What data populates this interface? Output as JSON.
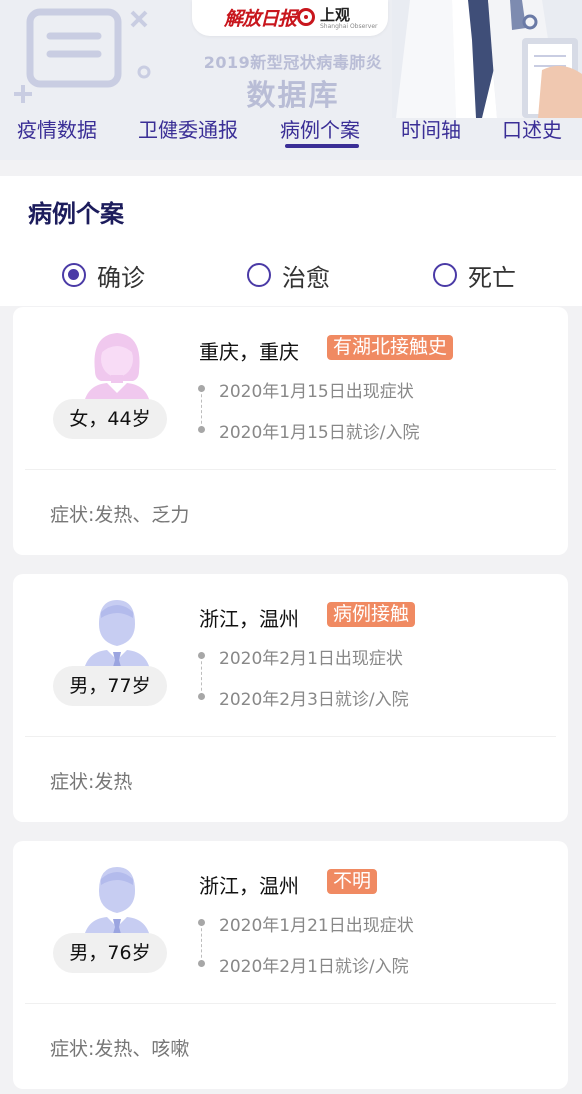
{
  "header": {
    "logo_jfrb": "解放日报",
    "logo_shangguan": "上观",
    "logo_shangguan_sub": "Shanghai Observer",
    "title_line1": "2019新型冠状病毒肺炎",
    "title_line2": "数据库",
    "nav": [
      {
        "label": "疫情数据"
      },
      {
        "label": "卫健委通报"
      },
      {
        "label": "病例个案",
        "active": true
      },
      {
        "label": "时间轴"
      },
      {
        "label": "口述史"
      }
    ],
    "accent_color": "#3a2e96"
  },
  "section": {
    "title": "病例个案",
    "filters": [
      {
        "label": "确诊",
        "selected": true
      },
      {
        "label": "治愈",
        "selected": false
      },
      {
        "label": "死亡",
        "selected": false
      }
    ]
  },
  "cases": [
    {
      "gender_icon": "female-avatar-icon",
      "person": "女，44岁",
      "location": "重庆，重庆",
      "tag": "有湖北接触史",
      "onset": "2020年1月15日出现症状",
      "admitted": "2020年1月15日就诊/入院",
      "symptoms": "症状:发热、乏力"
    },
    {
      "gender_icon": "male-avatar-icon",
      "person": "男，77岁",
      "location": "浙江，温州",
      "tag": "病例接触",
      "onset": "2020年2月1日出现症状",
      "admitted": "2020年2月3日就诊/入院",
      "symptoms": "症状:发热"
    },
    {
      "gender_icon": "male-avatar-icon",
      "person": "男，76岁",
      "location": "浙江，温州",
      "tag": "不明",
      "onset": "2020年1月21日出现症状",
      "admitted": "2020年2月1日就诊/入院",
      "symptoms": "症状:发热、咳嗽"
    }
  ],
  "colors": {
    "tag_bg": "#f08a62",
    "female_avatar": "#f0c8ee",
    "male_avatar": "#c7cdf2"
  }
}
